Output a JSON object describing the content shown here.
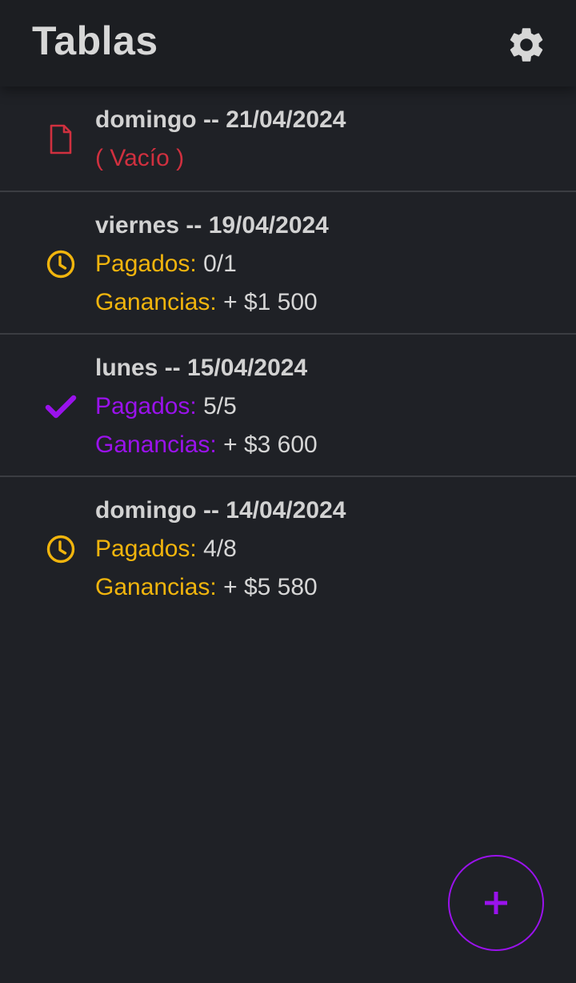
{
  "header": {
    "title": "Tablas",
    "settings_icon": "gear-icon"
  },
  "colors": {
    "background": "#1f2126",
    "header": "#1c1e22",
    "empty": "#d0303f",
    "pending": "#f2b50d",
    "complete": "#9a12ec",
    "text": "#d6d6d6"
  },
  "tables": [
    {
      "date": "domingo -- 21/04/2024",
      "status": "empty",
      "icon": "document-icon",
      "empty_text": "( Vacío )"
    },
    {
      "date": "viernes -- 19/04/2024",
      "status": "pending",
      "icon": "clock-icon",
      "paid_label": "Pagados:",
      "paid_value": "0/1",
      "earnings_label": "Ganancias:",
      "earnings_value": "+ $1 500"
    },
    {
      "date": "lunes -- 15/04/2024",
      "status": "complete",
      "icon": "checkmark-icon",
      "paid_label": "Pagados:",
      "paid_value": "5/5",
      "earnings_label": "Ganancias:",
      "earnings_value": "+ $3 600"
    },
    {
      "date": "domingo -- 14/04/2024",
      "status": "pending",
      "icon": "clock-icon",
      "paid_label": "Pagados:",
      "paid_value": "4/8",
      "earnings_label": "Ganancias:",
      "earnings_value": "+ $5 580"
    }
  ],
  "fab": {
    "icon": "plus-icon"
  }
}
